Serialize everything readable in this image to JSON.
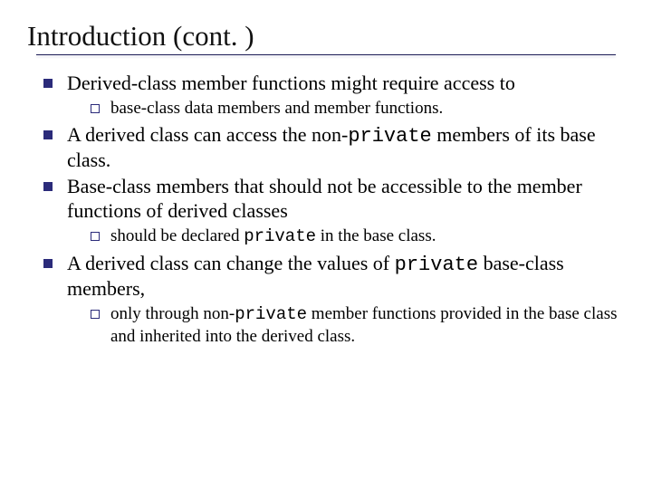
{
  "title": "Introduction (cont. )",
  "b1": {
    "text": "Derived-class member functions might require access to",
    "sub1": "base-class data members and member functions."
  },
  "b2": {
    "pre": "A derived class can access the non-",
    "code": "private",
    "post": " members of its base class."
  },
  "b3": {
    "text": "Base-class members that should not be accessible to the member functions of derived classes",
    "sub1_pre": "should be declared ",
    "sub1_code": "private",
    "sub1_post": " in the base class."
  },
  "b4": {
    "pre": "A derived class can change the values of ",
    "code": "private",
    "post": " base-class members,",
    "sub1_pre": "only through non-",
    "sub1_code": "private",
    "sub1_post": " member functions provided in the base class and inherited into the derived class."
  }
}
